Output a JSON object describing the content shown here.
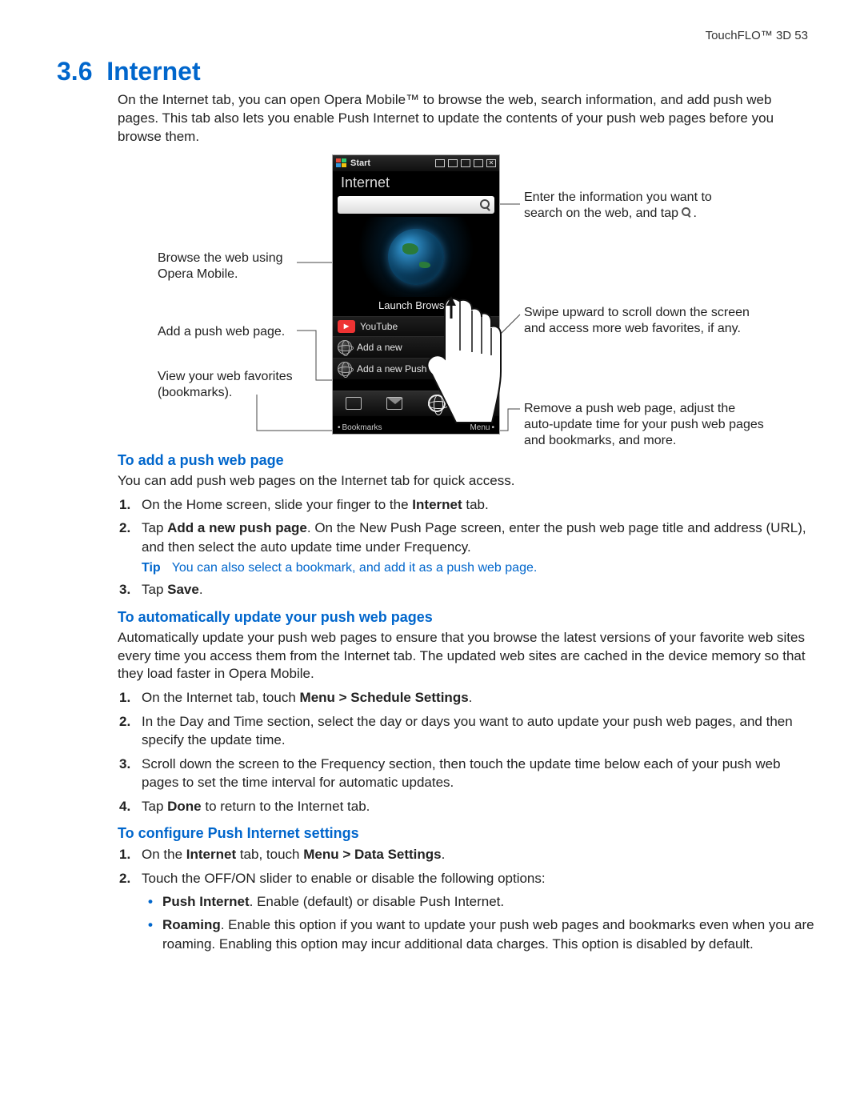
{
  "header": {
    "text": "TouchFLO™ 3D  53"
  },
  "section": {
    "number": "3.6",
    "title": "Internet",
    "intro": "On the Internet tab, you can open Opera Mobile™ to browse the web, search information, and add push web pages. This tab also lets you enable Push Internet to update the contents of your push web pages before you browse them."
  },
  "device": {
    "statusbar": {
      "start": "Start"
    },
    "title": "Internet",
    "launch_label": "Launch Browser",
    "list": {
      "youtube": "YouTube",
      "add_fav": "Add a new",
      "add_push": "Add a new Push"
    },
    "footer": {
      "left": "Bookmarks",
      "right": "Menu"
    }
  },
  "annotations": {
    "left1": "Browse the web using Opera Mobile.",
    "left2": "Add a push web page.",
    "left3": "View your web favorites (bookmarks).",
    "right1_a": "Enter the information you want to",
    "right1_b": "search on the web, and tap ",
    "right1_c": ".",
    "right2": "Swipe upward to scroll down the screen and access more web favorites, if any.",
    "right3": "Remove a push web page, adjust the auto-update time for your push web pages and bookmarks, and more."
  },
  "sub1": {
    "heading": "To add a push web page",
    "lead": "You can add push web pages on the Internet tab for quick access.",
    "steps": {
      "s1_a": "On the Home screen, slide your finger to the ",
      "s1_b": "Internet",
      "s1_c": " tab.",
      "s2_a": "Tap ",
      "s2_b": "Add a new push page",
      "s2_c": ". On the New Push Page screen, enter the push web page title and address (URL), and then select the auto update time under Frequency.",
      "tip_label": "Tip",
      "tip_text": "You can also select a bookmark, and add it as a push web page.",
      "s3_a": "Tap ",
      "s3_b": "Save",
      "s3_c": "."
    }
  },
  "sub2": {
    "heading": "To automatically update your push web pages",
    "lead": "Automatically update your push web pages to ensure that you browse the latest versions of your favorite web sites every time you access them from the Internet tab. The updated web sites are cached in the device memory so that they load faster in Opera Mobile.",
    "steps": {
      "s1_a": "On the Internet tab, touch ",
      "s1_b": "Menu > Schedule Settings",
      "s1_c": ".",
      "s2": "In the Day and Time section, select the day or days you want to auto update your push web pages, and then specify the update time.",
      "s3": "Scroll down the screen to the Frequency section, then touch the update time below each of your push web pages to set the time interval for automatic updates.",
      "s4_a": "Tap ",
      "s4_b": "Done",
      "s4_c": " to return to the Internet tab."
    }
  },
  "sub3": {
    "heading": "To configure Push Internet settings",
    "steps": {
      "s1_a": "On the ",
      "s1_b": "Internet",
      "s1_c": " tab, touch ",
      "s1_d": "Menu > Data Settings",
      "s1_e": ".",
      "s2": "Touch the OFF/ON slider to enable or disable the following options:"
    },
    "bullets": {
      "b1_a": "Push Internet",
      "b1_b": ". Enable (default) or disable Push Internet.",
      "b2_a": "Roaming",
      "b2_b": ". Enable this option if you want to update your push web pages and bookmarks even when you are roaming. Enabling this option may incur additional data charges. This option is disabled by default."
    }
  }
}
